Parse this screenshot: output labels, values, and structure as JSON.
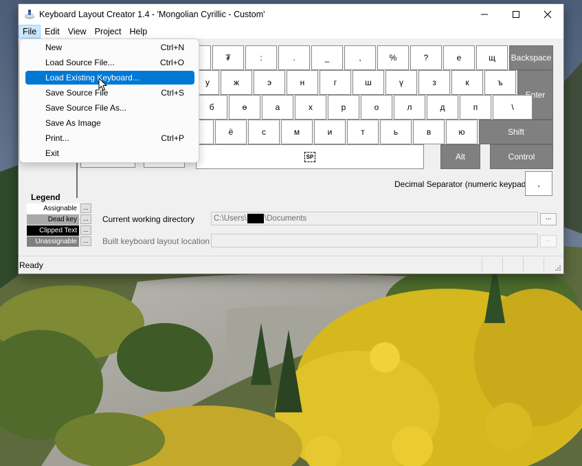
{
  "window": {
    "title": "Keyboard Layout Creator 1.4 - 'Mongolian Cyrillic - Custom'"
  },
  "menubar": {
    "items": [
      "File",
      "Edit",
      "View",
      "Project",
      "Help"
    ]
  },
  "file_menu": {
    "items": [
      {
        "label": "New",
        "shortcut": "Ctrl+N"
      },
      {
        "label": "Load Source File...",
        "shortcut": "Ctrl+O"
      },
      {
        "label": "Load Existing Keyboard...",
        "shortcut": ""
      },
      {
        "label": "Save Source File",
        "shortcut": "Ctrl+S"
      },
      {
        "label": "Save Source File As...",
        "shortcut": ""
      },
      {
        "label": "Save As Image",
        "shortcut": ""
      },
      {
        "label": "Print...",
        "shortcut": "Ctrl+P"
      },
      {
        "label": "Exit",
        "shortcut": ""
      }
    ],
    "highlighted_index": 2
  },
  "keyboard": {
    "row1": [
      "₮",
      ":",
      ".",
      "_",
      ",",
      "%",
      "?",
      "е",
      "щ"
    ],
    "row1_special": "Backspace",
    "row2": [
      "у",
      "ж",
      "э",
      "н",
      "г",
      "ш",
      "ү",
      "з",
      "к",
      "ъ"
    ],
    "row2_special": "Enter",
    "row3": [
      "б",
      "ө",
      "а",
      "х",
      "р",
      "о",
      "л",
      "д",
      "п",
      "\\"
    ],
    "row4": [
      "ё",
      "с",
      "м",
      "и",
      "т",
      "ь",
      "в",
      "ю"
    ],
    "row4_special": "Shift",
    "space_label": "SP",
    "alt_label": "Alt",
    "control_label": "Control",
    "decimal_separator_label": "Decimal Separator (numeric keypad)",
    "decimal_separator_value": ","
  },
  "legend": {
    "title": "Legend",
    "items": [
      {
        "label": "Assignable",
        "bg": "#ffffff",
        "fg": "#000000"
      },
      {
        "label": "Dead key",
        "bg": "#a9a9a9",
        "fg": "#000000"
      },
      {
        "label": "Clipped Text",
        "bg": "#000000",
        "fg": "#ffffff"
      },
      {
        "label": "Unassignable",
        "bg": "#808080",
        "fg": "#ffffff"
      }
    ],
    "button_label": "..."
  },
  "fields": {
    "cwd_label": "Current working directory",
    "cwd_value_prefix": "C:\\Users\\",
    "cwd_value_suffix": "\\Documents",
    "build_label": "Built keyboard layout location",
    "build_value": "",
    "browse_label": "..."
  },
  "status": {
    "text": "Ready"
  },
  "colors": {
    "accent": "#0078d4",
    "key_dark": "#808080",
    "menu_open": "#cce8ff"
  }
}
